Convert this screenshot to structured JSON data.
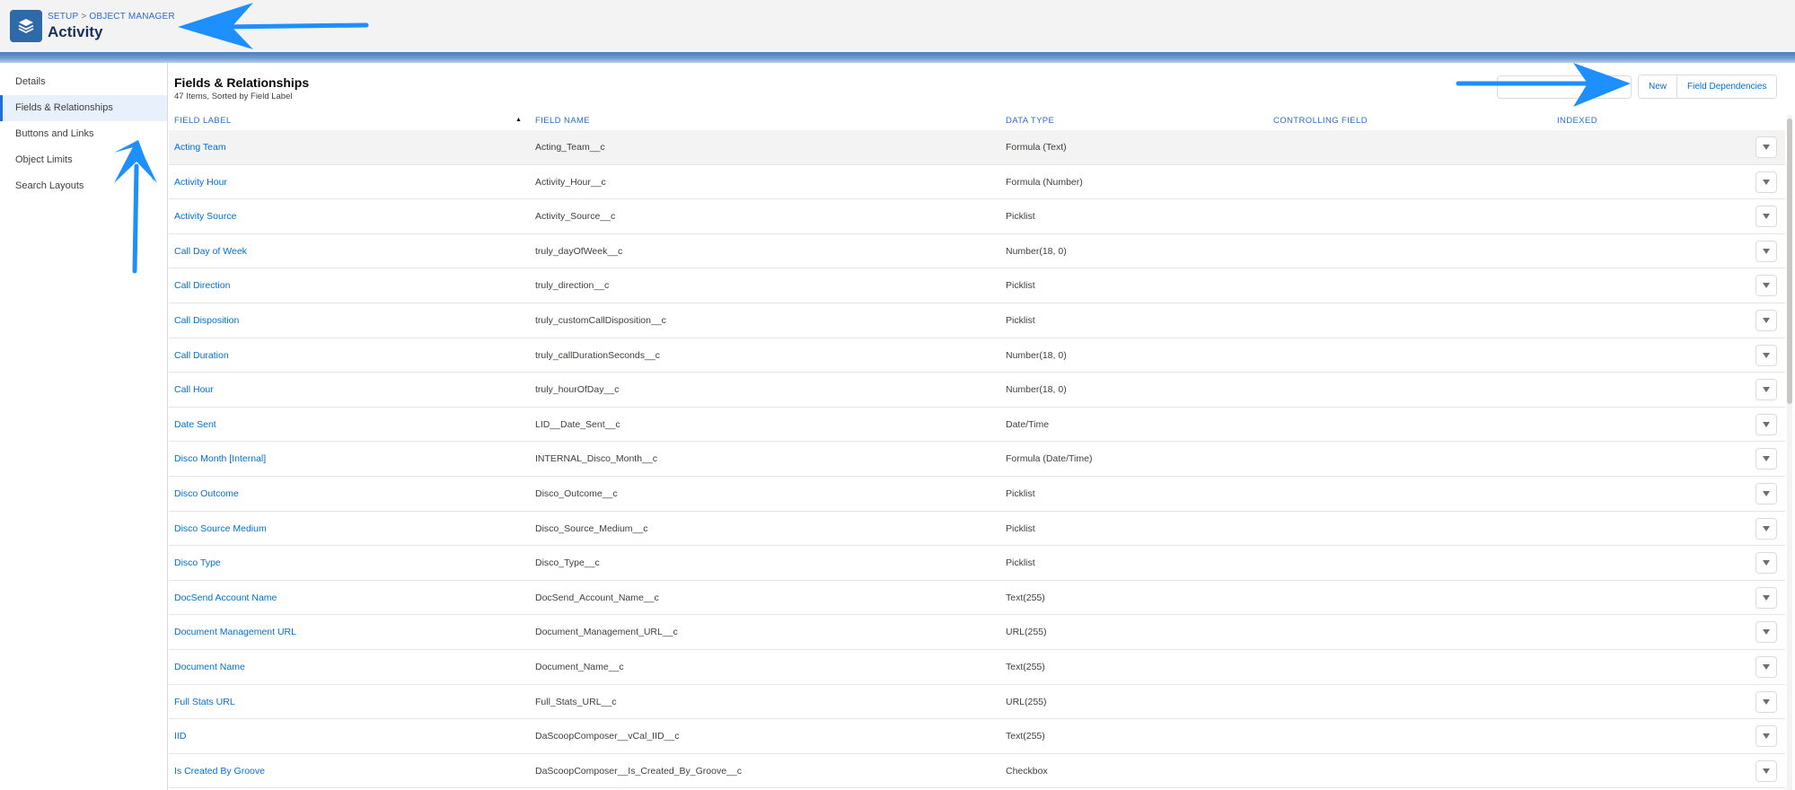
{
  "header": {
    "breadcrumb": [
      "SETUP",
      "OBJECT MANAGER"
    ],
    "breadcrumb_separator": ">",
    "title": "Activity",
    "app_icon": "layers-icon"
  },
  "sidebar": {
    "items": [
      {
        "label": "Details",
        "active": false
      },
      {
        "label": "Fields & Relationships",
        "active": true
      },
      {
        "label": "Buttons and Links",
        "active": false
      },
      {
        "label": "Object Limits",
        "active": false
      },
      {
        "label": "Search Layouts",
        "active": false
      }
    ]
  },
  "main": {
    "section_title": "Fields & Relationships",
    "section_subtitle": "47 Items, Sorted by Field Label",
    "quick_find_placeholder": "",
    "buttons": {
      "new": "New",
      "field_dependencies": "Field Dependencies"
    },
    "columns": [
      "FIELD LABEL",
      "FIELD NAME",
      "DATA TYPE",
      "CONTROLLING FIELD",
      "INDEXED"
    ],
    "sort_indicator": "▲",
    "rows": [
      {
        "label": "Acting Team",
        "api": "Acting_Team__c",
        "type": "Formula (Text)"
      },
      {
        "label": "Activity Hour",
        "api": "Activity_Hour__c",
        "type": "Formula (Number)"
      },
      {
        "label": "Activity Source",
        "api": "Activity_Source__c",
        "type": "Picklist"
      },
      {
        "label": "Call Day of Week",
        "api": "truly_dayOfWeek__c",
        "type": "Number(18, 0)"
      },
      {
        "label": "Call Direction",
        "api": "truly_direction__c",
        "type": "Picklist"
      },
      {
        "label": "Call Disposition",
        "api": "truly_customCallDisposition__c",
        "type": "Picklist"
      },
      {
        "label": "Call Duration",
        "api": "truly_callDurationSeconds__c",
        "type": "Number(18, 0)"
      },
      {
        "label": "Call Hour",
        "api": "truly_hourOfDay__c",
        "type": "Number(18, 0)"
      },
      {
        "label": "Date Sent",
        "api": "LID__Date_Sent__c",
        "type": "Date/Time"
      },
      {
        "label": "Disco Month [Internal]",
        "api": "INTERNAL_Disco_Month__c",
        "type": "Formula (Date/Time)"
      },
      {
        "label": "Disco Outcome",
        "api": "Disco_Outcome__c",
        "type": "Picklist"
      },
      {
        "label": "Disco Source Medium",
        "api": "Disco_Source_Medium__c",
        "type": "Picklist"
      },
      {
        "label": "Disco Type",
        "api": "Disco_Type__c",
        "type": "Picklist"
      },
      {
        "label": "DocSend Account Name",
        "api": "DocSend_Account_Name__c",
        "type": "Text(255)"
      },
      {
        "label": "Document Management URL",
        "api": "Document_Management_URL__c",
        "type": "URL(255)"
      },
      {
        "label": "Document Name",
        "api": "Document_Name__c",
        "type": "Text(255)"
      },
      {
        "label": "Full Stats URL",
        "api": "Full_Stats_URL__c",
        "type": "URL(255)"
      },
      {
        "label": "IID",
        "api": "DaScoopComposer__vCal_IID__c",
        "type": "Text(255)"
      },
      {
        "label": "Is Created By Groove",
        "api": "DaScoopComposer__Is_Created_By_Groove__c",
        "type": "Checkbox"
      }
    ]
  },
  "colors": {
    "link": "#0070d2",
    "header_text": "#2c6ad1",
    "title": "#16325c",
    "app_icon_bg": "#2e6aa8",
    "annotation_arrow": "#1e8fff",
    "active_nav_bg": "#e8f0fb"
  }
}
